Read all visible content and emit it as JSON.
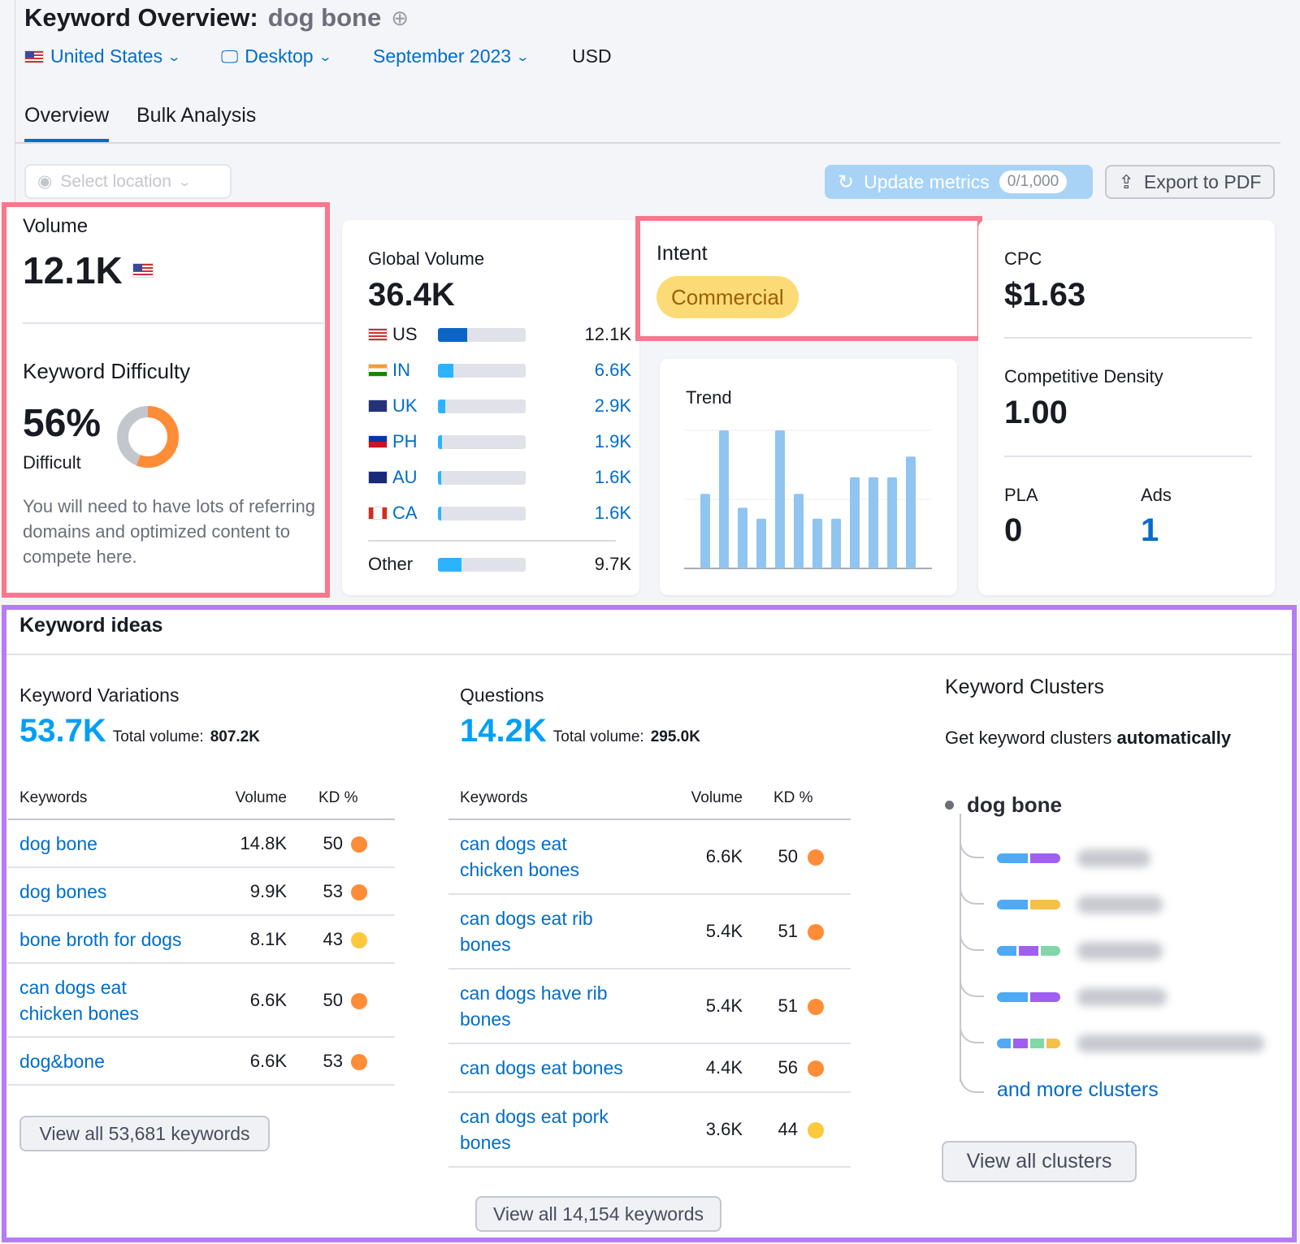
{
  "header": {
    "title": "Keyword Overview:",
    "keyword": "dog bone",
    "add_icon": "plus-circle-icon",
    "filters": {
      "country": "United States",
      "device": "Desktop",
      "date": "September 2023",
      "currency": "USD"
    },
    "tabs": [
      {
        "label": "Overview",
        "active": true
      },
      {
        "label": "Bulk Analysis",
        "active": false
      }
    ],
    "location_placeholder": "Select location",
    "update_label": "Update metrics",
    "update_count": "0/1,000",
    "export_label": "Export to PDF"
  },
  "volume": {
    "label": "Volume",
    "value": "12.1K",
    "flag": "us-flag"
  },
  "kd": {
    "label": "Keyword Difficulty",
    "value": "56%",
    "percent": 56,
    "level": "Difficult",
    "description": "You will need to have lots of referring domains and optimized content to compete here.",
    "color": "#ff8c37"
  },
  "global": {
    "label": "Global Volume",
    "value": "36.4K",
    "rows": [
      {
        "code": "US",
        "value": "12.1K",
        "share": 0.33
      },
      {
        "code": "IN",
        "value": "6.6K",
        "share": 0.18
      },
      {
        "code": "UK",
        "value": "2.9K",
        "share": 0.08
      },
      {
        "code": "PH",
        "value": "1.9K",
        "share": 0.05
      },
      {
        "code": "AU",
        "value": "1.6K",
        "share": 0.04
      },
      {
        "code": "CA",
        "value": "1.6K",
        "share": 0.04
      }
    ],
    "other": {
      "label": "Other",
      "value": "9.7K",
      "share": 0.27
    }
  },
  "intent": {
    "label": "Intent",
    "value": "Commercial",
    "color": "#fcdb76"
  },
  "trend": {
    "label": "Trend"
  },
  "chart_data": {
    "type": "bar",
    "title": "Trend",
    "values": [
      54,
      100,
      44,
      36,
      100,
      54,
      36,
      36,
      66,
      66,
      66,
      81
    ],
    "ylim": [
      0,
      100
    ],
    "grid": true,
    "color": "#8fc5f0"
  },
  "cpc": {
    "label": "CPC",
    "value": "$1.63"
  },
  "density": {
    "label": "Competitive Density",
    "value": "1.00"
  },
  "pla": {
    "label": "PLA",
    "value": "0"
  },
  "ads": {
    "label": "Ads",
    "value": "1"
  },
  "ideas": {
    "title": "Keyword ideas",
    "variations": {
      "label": "Keyword Variations",
      "count": "53.7K",
      "total_label": "Total volume:",
      "total": "807.2K",
      "headers": [
        "Keywords",
        "Volume",
        "KD %"
      ],
      "rows": [
        {
          "kw": [
            "dog bone"
          ],
          "vol": "14.8K",
          "kd": "50",
          "c": "#ff8c37"
        },
        {
          "kw": [
            "dog bones"
          ],
          "vol": "9.9K",
          "kd": "53",
          "c": "#ff8c37"
        },
        {
          "kw": [
            "bone broth for dogs"
          ],
          "vol": "8.1K",
          "kd": "43",
          "c": "#fcc83c"
        },
        {
          "kw": [
            "can dogs eat",
            "chicken bones"
          ],
          "vol": "6.6K",
          "kd": "50",
          "c": "#ff8c37"
        },
        {
          "kw": [
            "dog&bone"
          ],
          "vol": "6.6K",
          "kd": "53",
          "c": "#ff8c37"
        }
      ],
      "button": "View all 53,681 keywords"
    },
    "questions": {
      "label": "Questions",
      "count": "14.2K",
      "total_label": "Total volume:",
      "total": "295.0K",
      "headers": [
        "Keywords",
        "Volume",
        "KD %"
      ],
      "rows": [
        {
          "kw": [
            "can dogs eat",
            "chicken bones"
          ],
          "vol": "6.6K",
          "kd": "50",
          "c": "#ff8c37"
        },
        {
          "kw": [
            "can dogs eat rib",
            "bones"
          ],
          "vol": "5.4K",
          "kd": "51",
          "c": "#ff8c37"
        },
        {
          "kw": [
            "can dogs have rib",
            "bones"
          ],
          "vol": "5.4K",
          "kd": "51",
          "c": "#ff8c37"
        },
        {
          "kw": [
            "can dogs eat bones"
          ],
          "vol": "4.4K",
          "kd": "56",
          "c": "#ff8c37"
        },
        {
          "kw": [
            "can dogs eat pork",
            "bones"
          ],
          "vol": "3.6K",
          "kd": "44",
          "c": "#fcc83c"
        }
      ],
      "button": "View all 14,154 keywords"
    },
    "clusters": {
      "label": "Keyword Clusters",
      "subtitle": "Get keyword clusters",
      "subtitle_bold": "automatically",
      "root": "dog bone",
      "rows": [
        [
          "#4eaaf5",
          "#9f5ff0"
        ],
        [
          "#4eaaf5",
          "#f4c04a"
        ],
        [
          "#4eaaf5",
          "#9f5ff0",
          "#7fd8a5"
        ],
        [
          "#4eaaf5",
          "#9f5ff0"
        ],
        [
          "#4eaaf5",
          "#9f5ff0",
          "#7fd8a5",
          "#f4c04a"
        ]
      ],
      "more": "and more clusters",
      "button": "View all clusters"
    }
  }
}
